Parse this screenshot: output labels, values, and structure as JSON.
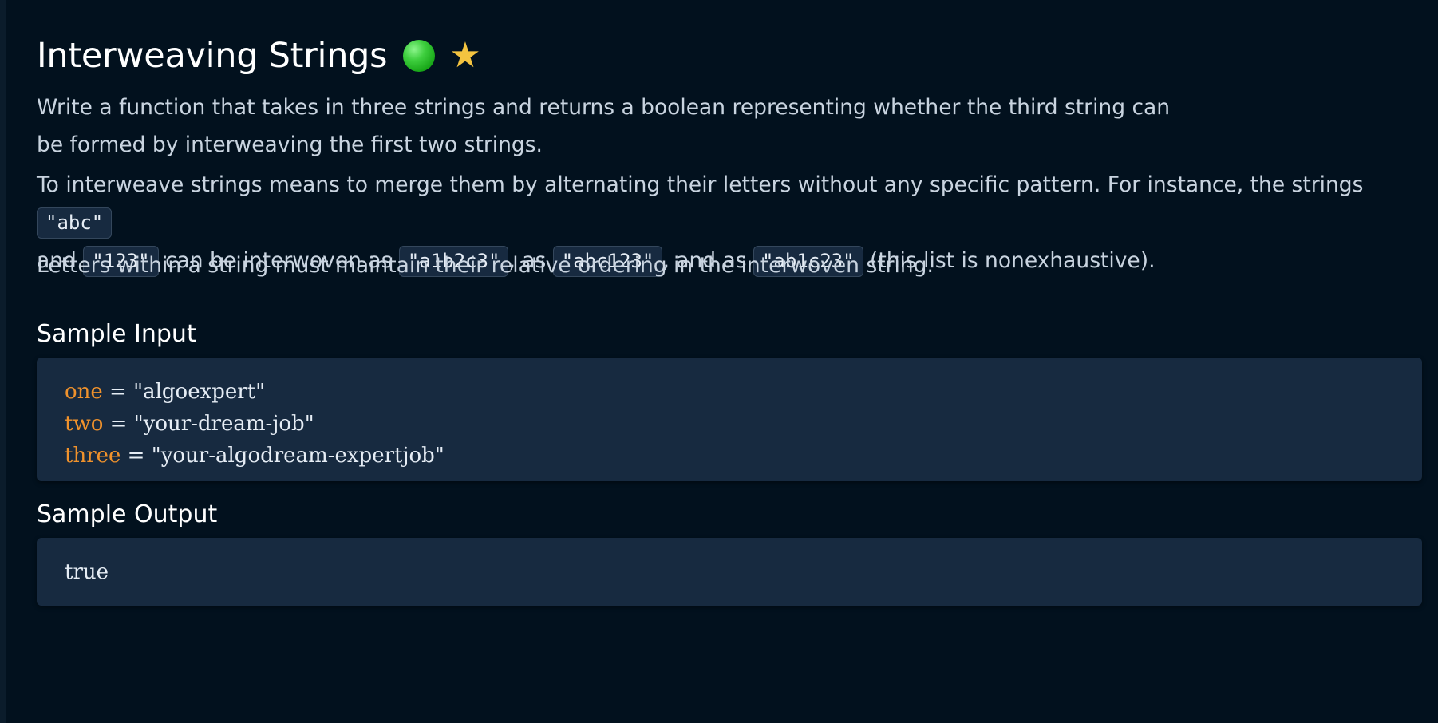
{
  "title": "Interweaving Strings",
  "difficulty_icon": "green-circle",
  "favorite_icon": "star",
  "paragraphs": {
    "p1": "Write a function that takes in three strings and returns a boolean representing whether the third string can be formed by interweaving the first two strings.",
    "p2": {
      "t1": "To interweave strings means to merge them by alternating their letters without any specific pattern. For instance, the strings ",
      "c1": "\"abc\"",
      "t2": "and ",
      "c2": "\"123\"",
      "t3": " can be interwoven as ",
      "c3": "\"a1b2c3\"",
      "t4": ", as ",
      "c4": "\"abc123\"",
      "t5": ", and as ",
      "c5": "\"ab1c23\"",
      "t6": " (this list is nonexhaustive)."
    },
    "p3": "Letters within a string must maintain their relative ordering in the interwoven string."
  },
  "sample_input": {
    "heading": "Sample Input",
    "lines": [
      {
        "name": "one",
        "eq": " = ",
        "value": "\"algoexpert\""
      },
      {
        "name": "two",
        "eq": " = ",
        "value": "\"your-dream-job\""
      },
      {
        "name": "three",
        "eq": " = ",
        "value": "\"your-algodream-expertjob\""
      }
    ]
  },
  "sample_output": {
    "heading": "Sample Output",
    "value": "true"
  },
  "colors": {
    "background": "#02111e",
    "code_background": "#172a40",
    "keyword": "#f0922c",
    "difficulty_easy": "#2dbd2d",
    "star": "#f4c440"
  }
}
